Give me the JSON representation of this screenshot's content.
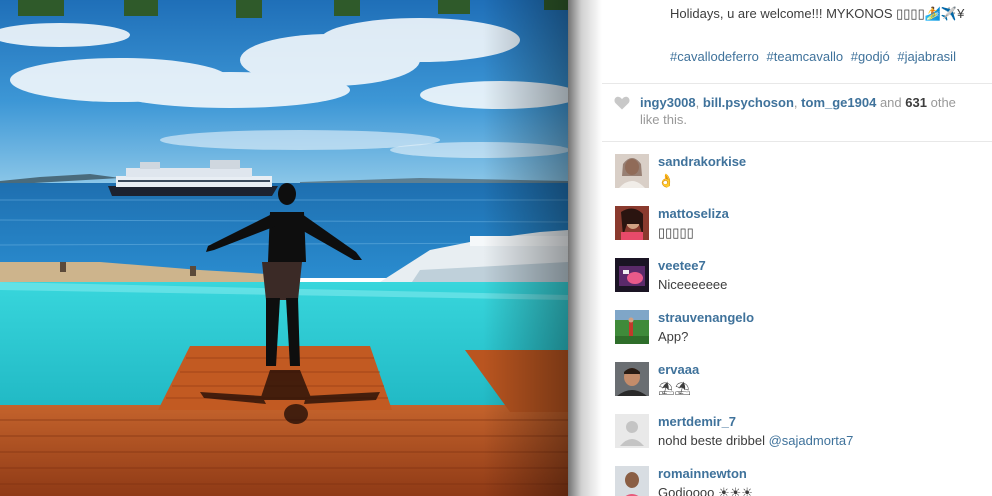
{
  "post": {
    "caption_line": "Holidays, u are welcome!!! MYKONOS ▯▯▯▯🏄✈️¥",
    "hashtags": [
      "#cavallodeferro",
      "#teamcavallo",
      "#godjó",
      "#jajabrasil"
    ]
  },
  "likes": {
    "users": [
      "ingy3008",
      "bill.psychoson",
      "tom_ge1904"
    ],
    "sep1": ",",
    "sep2": ",",
    "and_text": "and",
    "count": "631",
    "others_text": "othe",
    "tail": "like this."
  },
  "comments": [
    {
      "user": "sandrakorkise",
      "text": "👌"
    },
    {
      "user": "mattoseliza",
      "text": "▯▯▯▯▯"
    },
    {
      "user": "veetee7",
      "text": "Niceeeeeee"
    },
    {
      "user": "strauvenangelo",
      "text": "App?"
    },
    {
      "user": "ervaaa",
      "text": "⛱⛱"
    },
    {
      "user": "mertdemir_7",
      "text": "nohd beste dribbel",
      "mention": "@sajadmorta7"
    },
    {
      "user": "romainnewton",
      "text": "Godjoooo ☀☀☀"
    }
  ],
  "colors": {
    "link": "#3f729b",
    "text": "#3d3d3d",
    "muted": "#999999"
  },
  "icons": {
    "like": "heart-icon"
  }
}
